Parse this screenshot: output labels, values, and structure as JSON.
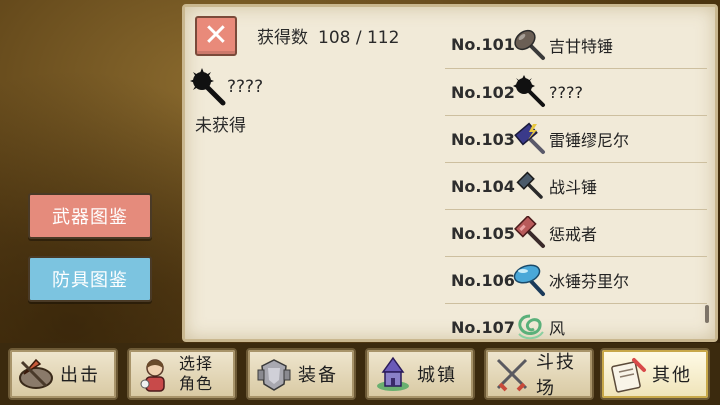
{
  "header": {
    "close_symbol": "✕",
    "count_label": "获得数",
    "count_value": "108 / 112"
  },
  "detail": {
    "name": "????",
    "status": "未获得"
  },
  "items": [
    {
      "no": "No.101",
      "name": "吉甘特锤",
      "icon": "hammer-round-icon",
      "color": "#6b5f55"
    },
    {
      "no": "No.102",
      "name": "????",
      "icon": "unknown-mace-icon",
      "color": "#111111"
    },
    {
      "no": "No.103",
      "name": "雷锤缪尼尔",
      "icon": "thunder-hammer-icon",
      "color": "#3a3a8a"
    },
    {
      "no": "No.104",
      "name": "战斗锤",
      "icon": "battle-hammer-icon",
      "color": "#4a5a6a"
    },
    {
      "no": "No.105",
      "name": "惩戒者",
      "icon": "punisher-hammer-icon",
      "color": "#b85a5a"
    },
    {
      "no": "No.106",
      "name": "冰锤芬里尔",
      "icon": "ice-hammer-icon",
      "color": "#4aa8d8"
    },
    {
      "no": "No.107",
      "name": "风",
      "icon": "wind-icon",
      "color": "#5ab07a"
    }
  ],
  "side": {
    "weapon_label": "武器图鉴",
    "armor_label": "防具图鉴"
  },
  "tabs": [
    {
      "label": "出击",
      "icon": "sortie-icon"
    },
    {
      "label": "选择角色",
      "line1": "选择",
      "line2": "角色",
      "icon": "character-icon"
    },
    {
      "label": "装备",
      "icon": "equipment-icon"
    },
    {
      "label": "城镇",
      "icon": "town-icon"
    },
    {
      "label": "斗技场",
      "icon": "arena-icon"
    },
    {
      "label": "其他",
      "icon": "other-icon"
    }
  ],
  "colors": {
    "close_button": "#e98a7a",
    "weapon_button": "#e58b7c",
    "armor_button": "#7cc4e0",
    "parchment": "#f1ead8"
  }
}
